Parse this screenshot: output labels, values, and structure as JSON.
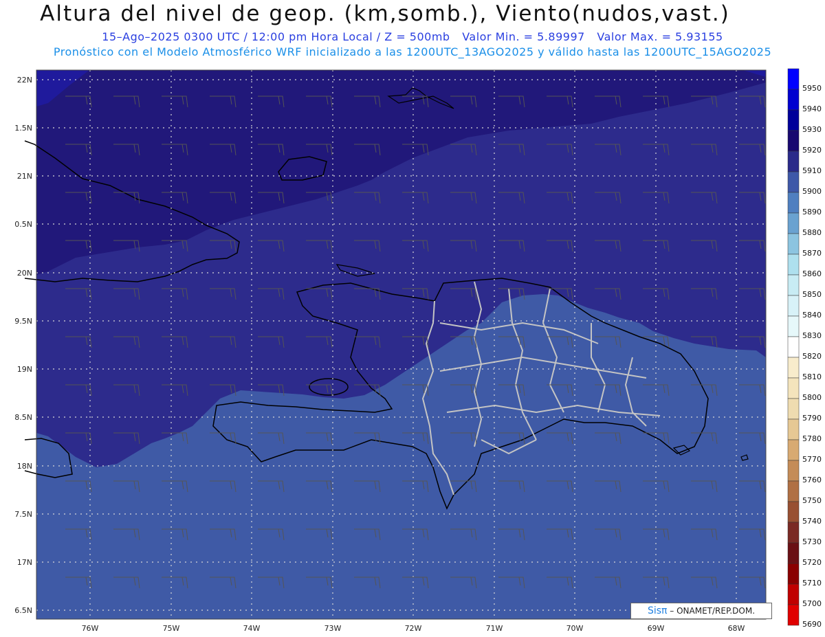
{
  "header": {
    "title": "Altura del nivel de geop. (km,somb.), Viento(nudos,vast.)",
    "date_time": "15–Ago–2025  0300 UTC / 12:00 pm Hora Local / Z = 500mb",
    "min_value": "Valor Min. = 5.89997",
    "max_value": "Valor Max. = 5.93155",
    "model_info": "Pronóstico con el Modelo Atmosférico WRF inicializado a las 1200UTC_13AGO2025 y válido hasta las  1200UTC_15AGO2025"
  },
  "map": {
    "lat_labels": [
      "22N",
      "1.5N",
      "21N",
      "0.5N",
      "20N",
      "9.5N",
      "19N",
      "8.5N",
      "18N",
      "7.5N",
      "17N",
      "6.5N"
    ],
    "lon_labels": [
      "76W",
      "75W",
      "74W",
      "73W",
      "72W",
      "71W",
      "70W",
      "69W",
      "68W"
    ],
    "colors": {
      "field_5930": "#21187a",
      "field_5920": "#2d2b8c",
      "field_5910": "#3f5aa6",
      "field_5940": "#1f1a9c",
      "coastline": "#000000",
      "borders": "#bbbbbb",
      "gridline": "#dddddd"
    }
  },
  "colorbar": {
    "levels": [
      "5950",
      "5940",
      "5930",
      "5920",
      "5910",
      "5900",
      "5890",
      "5880",
      "5870",
      "5860",
      "5850",
      "5840",
      "5830",
      "5820",
      "5810",
      "5800",
      "5790",
      "5780",
      "5770",
      "5760",
      "5750",
      "5740",
      "5730",
      "5720",
      "5710",
      "5700",
      "5690"
    ],
    "colors": [
      "#0000ff",
      "#0000d0",
      "#00009a",
      "#180870",
      "#2a2a8a",
      "#3e58a8",
      "#4f7fc0",
      "#6aa2d0",
      "#8cc4e0",
      "#aee0ee",
      "#c8ecf4",
      "#d8f2f8",
      "#e6f8fa",
      "#ffffff",
      "#f8eccc",
      "#f4e4bc",
      "#efdcb0",
      "#e6c894",
      "#d8aa72",
      "#c48c58",
      "#b07044",
      "#985032",
      "#7a2a24",
      "#6a1014",
      "#8a0000",
      "#c00000",
      "#e00000"
    ]
  },
  "credit": {
    "logo_text": "Sisπ",
    "org": "– ONAMET/REP.DOM."
  }
}
